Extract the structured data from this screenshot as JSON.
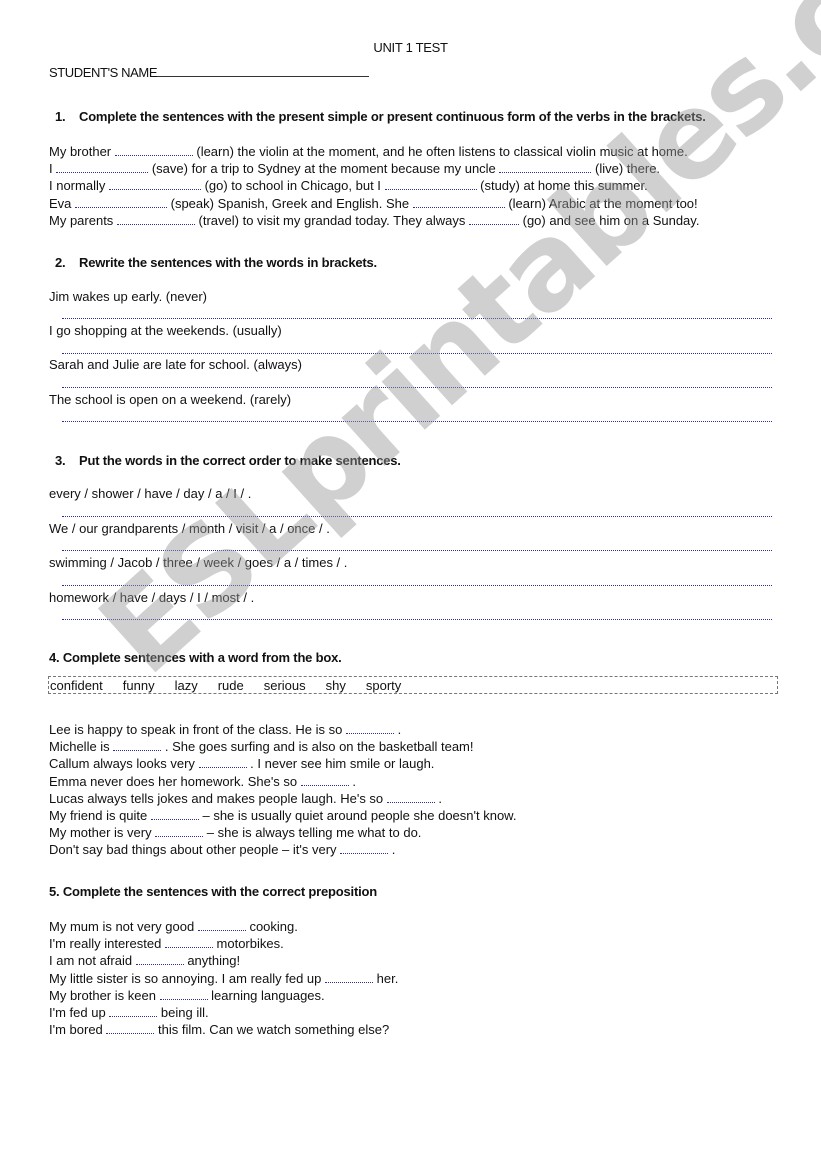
{
  "header": {
    "title": "UNIT 1 TEST",
    "student_name_label": "STUDENT'S NAME"
  },
  "watermark": "ESLprintables.com",
  "colors": {
    "blank_line": "#2b2f9a",
    "watermark": "#969696"
  },
  "section1": {
    "number": "1.",
    "instruction": "Complete the sentences with the present simple or present continuous form of the verbs in the brackets.",
    "lines": [
      [
        "My brother ",
        " (learn) the violin at the moment, and he often listens to classical violin music at home."
      ],
      [
        "I ",
        " (save) for a trip to Sydney at the moment because my uncle ",
        " (live) there."
      ],
      [
        "I normally ",
        " (go) to school in Chicago, but I ",
        " (study) at home this summer."
      ],
      [
        "Eva ",
        " (speak) Spanish, Greek and English. She ",
        " (learn) Arabic at the moment too!"
      ],
      [
        "My parents ",
        " (travel) to visit my grandad today. They always ",
        " (go) and see him on a Sunday."
      ]
    ]
  },
  "section2": {
    "number": "2.",
    "instruction": "Rewrite the sentences with the words in brackets.",
    "questions": [
      "Jim wakes up early. (never)",
      "I go shopping at the weekends. (usually)",
      "Sarah and Julie are late for school. (always)",
      "The school is open on a weekend. (rarely)"
    ]
  },
  "section3": {
    "number": "3.",
    "instruction": "Put the words in the correct order to make sentences.",
    "questions": [
      "every / shower / have / day / a / I / .",
      "We / our grandparents / month / visit / a / once / .",
      "swimming / Jacob / three / week / goes / a / times / .",
      "homework / have / days / I / most / ."
    ]
  },
  "section4": {
    "instruction": "4. Complete sentences with a word from the box.",
    "words": [
      "confident",
      "funny",
      "lazy",
      "rude",
      "serious",
      "shy",
      "sporty"
    ],
    "lines": [
      [
        "Lee is happy to speak in front of the class. He is so ",
        " ."
      ],
      [
        "Michelle is ",
        " . She goes surfing and is also on the basketball team!"
      ],
      [
        "Callum always looks very ",
        " . I never see him smile or laugh."
      ],
      [
        "Emma never does her homework. She's so ",
        " ."
      ],
      [
        "Lucas always tells jokes and makes people laugh. He's so ",
        " ."
      ],
      [
        "My friend is quite ",
        " – she is usually quiet around people she doesn't know."
      ],
      [
        "My mother is very ",
        " – she is always telling me what to do."
      ],
      [
        "Don't say bad things about other people – it's very ",
        " ."
      ]
    ]
  },
  "section5": {
    "instruction": "5. Complete the sentences with the correct preposition",
    "lines": [
      [
        "My mum is not very good ",
        " cooking."
      ],
      [
        "I'm really interested ",
        " motorbikes."
      ],
      [
        "I am not afraid ",
        " anything!"
      ],
      [
        "My little sister is so annoying. I am really fed up ",
        " her."
      ],
      [
        "My brother is keen ",
        " learning languages."
      ],
      [
        "I'm fed up ",
        " being ill."
      ],
      [
        "I'm bored ",
        " this film. Can we watch something else?"
      ]
    ]
  }
}
